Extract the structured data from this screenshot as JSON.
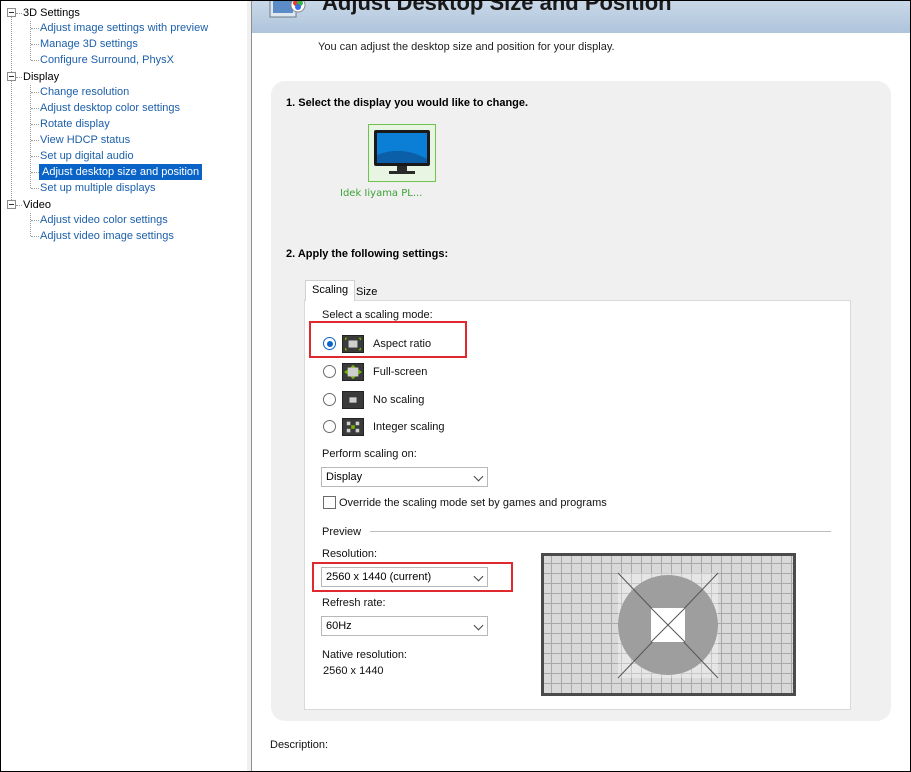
{
  "tree": {
    "categories": [
      {
        "label": "3D Settings",
        "items": [
          "Adjust image settings with preview",
          "Manage 3D settings",
          "Configure Surround, PhysX"
        ]
      },
      {
        "label": "Display",
        "items": [
          "Change resolution",
          "Adjust desktop color settings",
          "Rotate display",
          "View HDCP status",
          "Set up digital audio",
          "Adjust desktop size and position",
          "Set up multiple displays"
        ]
      },
      {
        "label": "Video",
        "items": [
          "Adjust video color settings",
          "Adjust video image settings"
        ]
      }
    ],
    "selected": "Adjust desktop size and position"
  },
  "header": {
    "title": "Adjust Desktop Size and Position",
    "subtitle": "You can adjust the desktop size and position for your display."
  },
  "step1": {
    "title": "1. Select the display you would like to change.",
    "display_name": "Idek Iiyama PL..."
  },
  "step2": {
    "title": "2. Apply the following settings:",
    "tabs": [
      "Scaling",
      "Size"
    ],
    "active_tab": "Scaling",
    "scaling_mode_label": "Select a scaling mode:",
    "modes": [
      "Aspect ratio",
      "Full-screen",
      "No scaling",
      "Integer scaling"
    ],
    "selected_mode": "Aspect ratio",
    "perform_on_label": "Perform scaling on:",
    "perform_on_value": "Display",
    "override_label": "Override the scaling mode set by games and programs",
    "override_checked": false,
    "preview_label": "Preview",
    "resolution_label": "Resolution:",
    "resolution_value": "2560 x 1440 (current)",
    "refresh_label": "Refresh rate:",
    "refresh_value": "60Hz",
    "native_label": "Native resolution:",
    "native_value": "2560 x 1440"
  },
  "description_label": "Description:",
  "colors": {
    "accent": "#0a64c8",
    "highlight": "#e0282f",
    "display_green": "#3ca335"
  }
}
